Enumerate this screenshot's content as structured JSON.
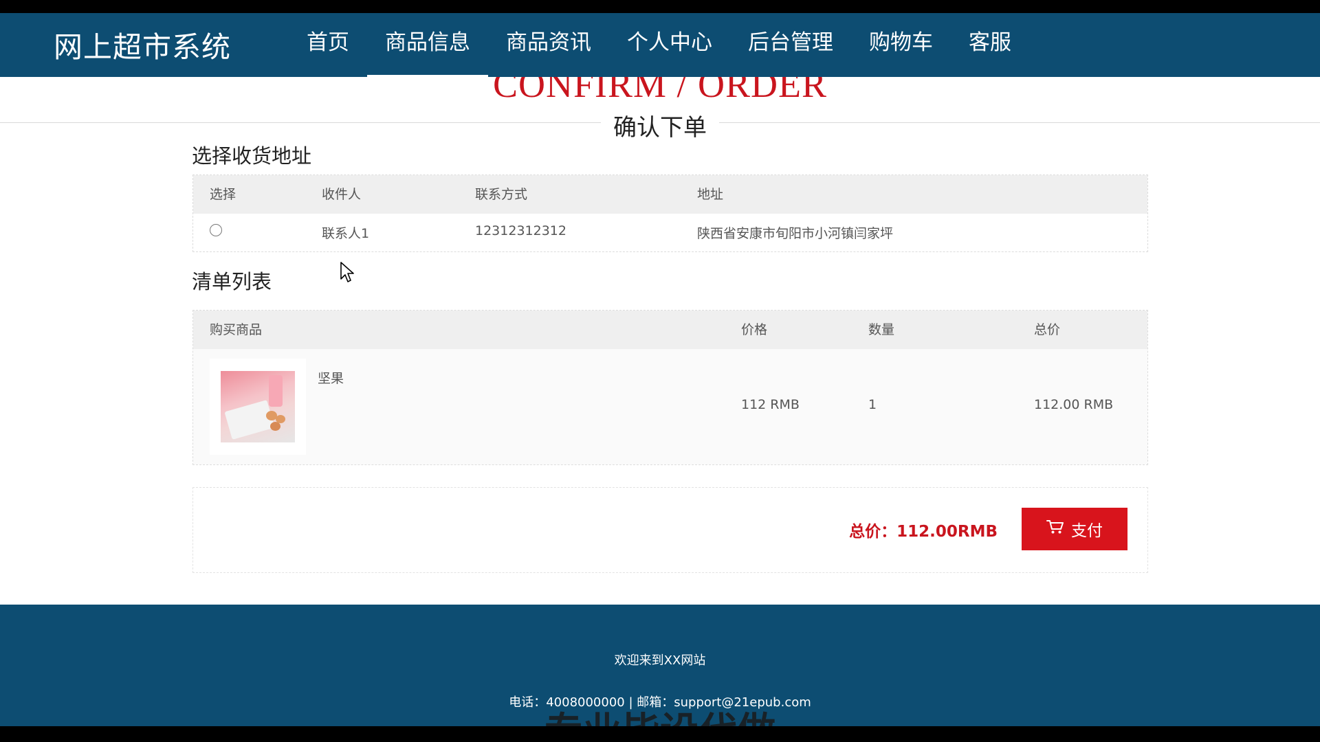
{
  "app": {
    "brand": "网上超市系统",
    "nav": [
      "首页",
      "商品信息",
      "商品资讯",
      "个人中心",
      "后台管理",
      "购物车",
      "客服"
    ],
    "active_nav": "商品信息"
  },
  "header": {
    "title_en": "CONFIRM / ORDER",
    "title_cn": "确认下单"
  },
  "address_section": {
    "title": "选择收货地址",
    "columns": [
      "选择",
      "收件人",
      "联系方式",
      "地址"
    ],
    "rows": [
      {
        "selected": false,
        "recipient": "联系人1",
        "phone": "12312312312",
        "address": "陕西省安康市旬阳市小河镇闫家坪"
      }
    ]
  },
  "order_section": {
    "title": "清单列表",
    "columns": [
      "购买商品",
      "价格",
      "数量",
      "总价"
    ],
    "items": [
      {
        "name": "坚果",
        "price": "112 RMB",
        "quantity": "1",
        "total": "112.00 RMB"
      }
    ]
  },
  "summary": {
    "total_label": "总价：",
    "total_value": "112.00RMB",
    "pay_label": "支付"
  },
  "footer": {
    "welcome": "欢迎来到XX网站",
    "contact": "电话：4008000000 | 邮箱：support@21epub.com",
    "watermark": "专业毕设代做"
  },
  "colors": {
    "navbar": "#0d4d72",
    "accent_red": "#c9151e",
    "pay_button": "#d8141c"
  },
  "icons": {
    "pay": "cart-icon"
  }
}
